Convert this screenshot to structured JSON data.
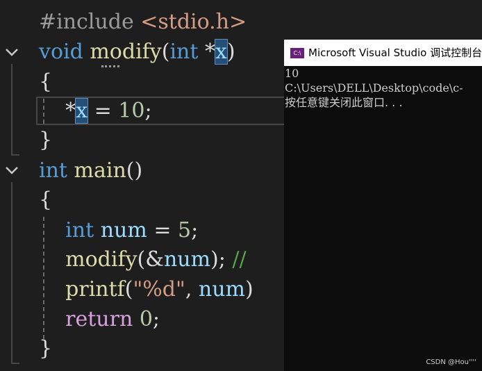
{
  "code": {
    "l1": {
      "pp": "#include ",
      "inc": "<stdio.h>"
    },
    "l2": {
      "kw": "void",
      "fn": "modify",
      "open": "(",
      "kw2": "int",
      "star": " *",
      "x": "x",
      "close": ")"
    },
    "l3": "{",
    "l4": {
      "star": "*",
      "x": "x",
      "rest": " = ",
      "num": "10",
      "semi": ";"
    },
    "l5": "}",
    "l6": {
      "kw": "int",
      "fn": "main",
      "parens": "()"
    },
    "l7": "{",
    "l8": {
      "kw": "int",
      "var": "num",
      "eq": " = ",
      "num": "5",
      "semi": ";"
    },
    "l9": {
      "fn": "modify",
      "open": "(&",
      "var": "num",
      "close": ");",
      "cmt": " //"
    },
    "l10": {
      "fn": "printf",
      "open": "(",
      "str": "\"%d\"",
      "comma": ", ",
      "var": "num",
      "close": ")"
    },
    "l11": {
      "ctl": "return",
      "num": " 0",
      "semi": ";"
    },
    "l12": "}"
  },
  "console": {
    "app_icon": "C:\\",
    "title": "Microsoft Visual Studio 调试控制台",
    "output": [
      "10",
      "C:\\Users\\DELL\\Desktop\\code\\c-",
      "按任意键关闭此窗口. . ."
    ]
  },
  "watermark": "CSDN @Hou''''",
  "colors": {
    "editor_bg": "#1e1e1e",
    "keyword": "#569cd6",
    "function": "#dcdcaa",
    "variable": "#9cdcfe",
    "number": "#b5cea8",
    "comment": "#57a64a",
    "console_bg": "#0c0c0c"
  }
}
